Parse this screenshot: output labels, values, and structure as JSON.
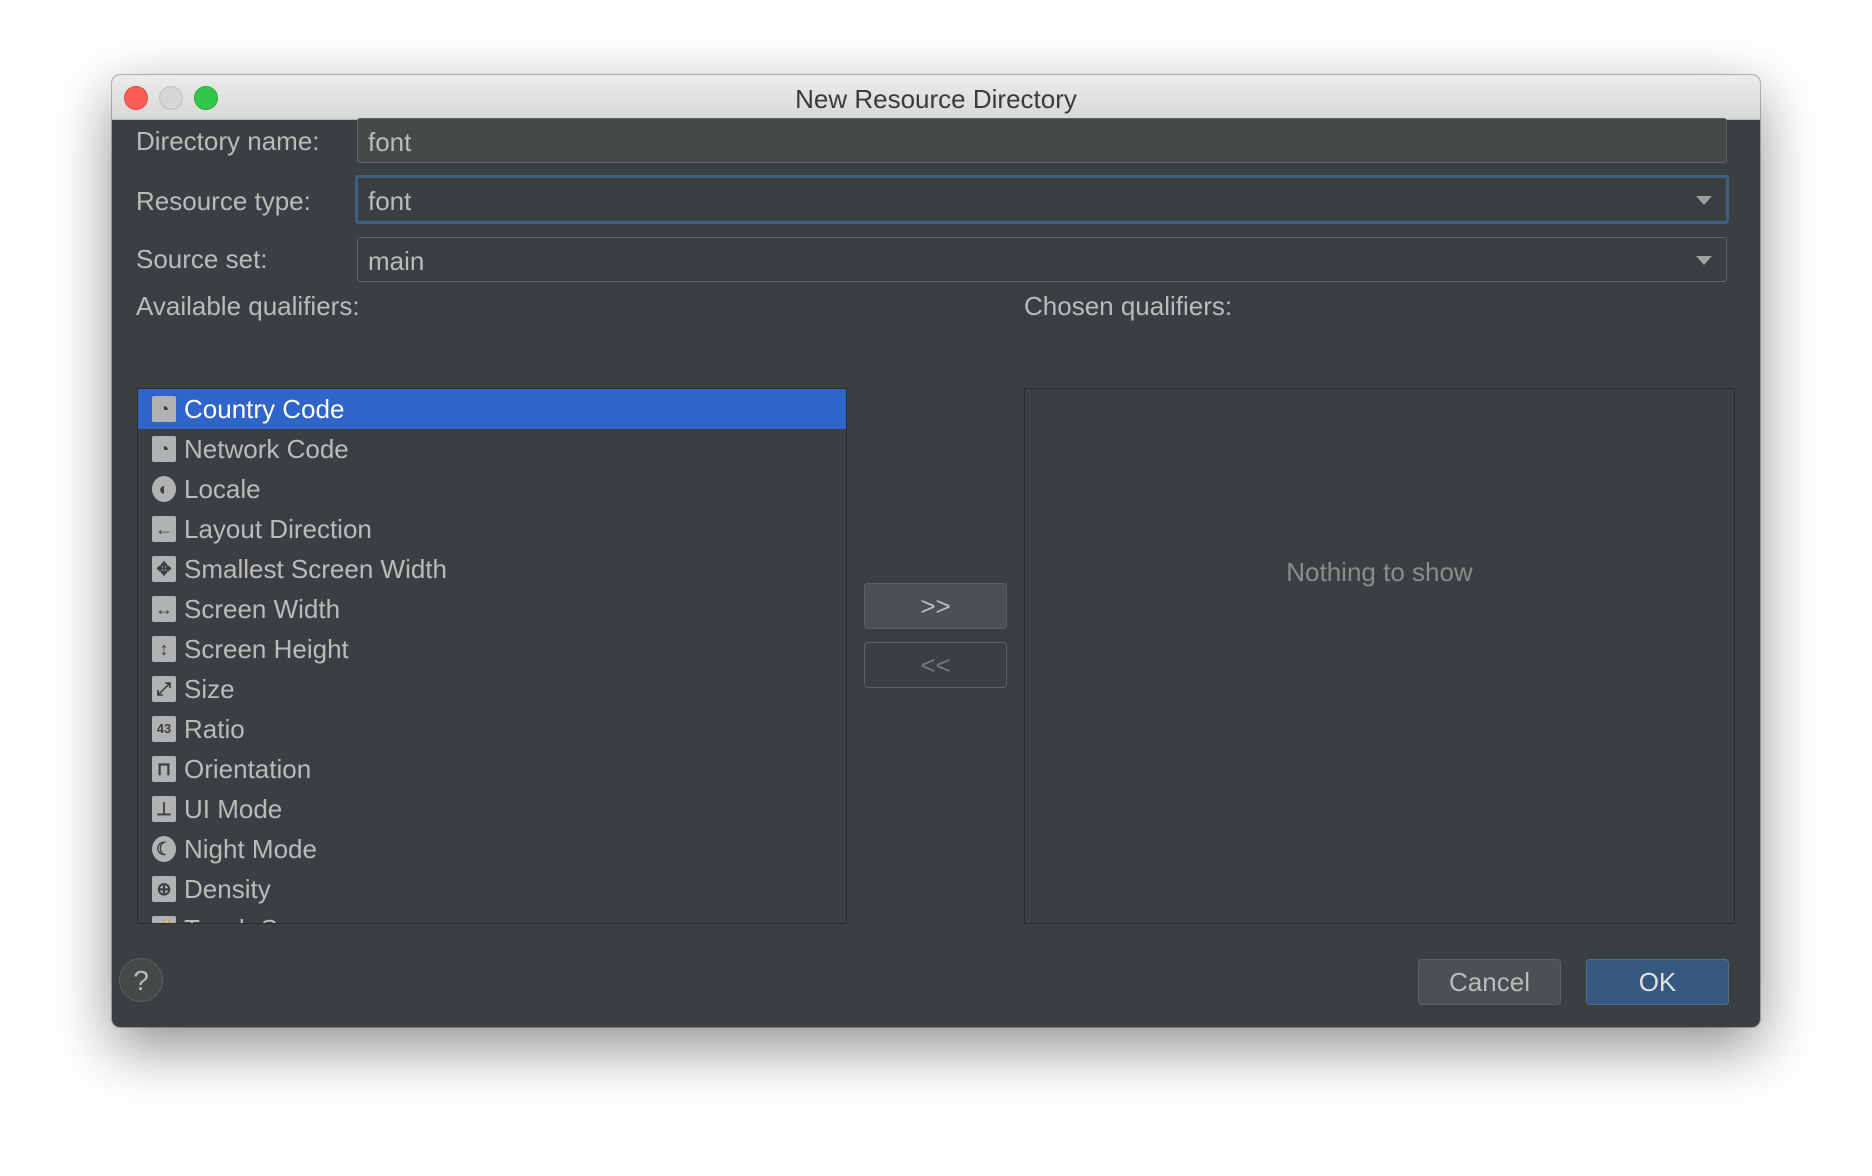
{
  "window": {
    "title": "New Resource Directory"
  },
  "form": {
    "directory_name": {
      "label": "Directory name:",
      "value": "font"
    },
    "resource_type": {
      "label": "Resource type:",
      "value": "font"
    },
    "source_set": {
      "label": "Source set:",
      "value": "main"
    }
  },
  "available": {
    "label": "Available qualifiers:",
    "items": [
      {
        "label": "Country Code",
        "icon": "country-code-icon",
        "glyph": "◔",
        "selected": true
      },
      {
        "label": "Network Code",
        "icon": "network-code-icon",
        "glyph": "◔"
      },
      {
        "label": "Locale",
        "icon": "globe-icon",
        "glyph": "◐"
      },
      {
        "label": "Layout Direction",
        "icon": "arrow-left-icon",
        "glyph": "←"
      },
      {
        "label": "Smallest Screen Width",
        "icon": "move-arrows-icon",
        "glyph": "✥"
      },
      {
        "label": "Screen Width",
        "icon": "horizontal-arrows-icon",
        "glyph": "↔"
      },
      {
        "label": "Screen Height",
        "icon": "vertical-arrows-icon",
        "glyph": "↕"
      },
      {
        "label": "Size",
        "icon": "resize-icon",
        "glyph": "⤢"
      },
      {
        "label": "Ratio",
        "icon": "ratio-icon",
        "glyph": "43"
      },
      {
        "label": "Orientation",
        "icon": "orientation-icon",
        "glyph": "⊓"
      },
      {
        "label": "UI Mode",
        "icon": "ui-mode-icon",
        "glyph": "⊥"
      },
      {
        "label": "Night Mode",
        "icon": "moon-icon",
        "glyph": "☾"
      },
      {
        "label": "Density",
        "icon": "density-icon",
        "glyph": "⊕"
      },
      {
        "label": "Touch Screen",
        "icon": "touch-screen-icon",
        "glyph": "☝"
      }
    ]
  },
  "chosen": {
    "label": "Chosen qualifiers:",
    "empty_text": "Nothing to show"
  },
  "buttons": {
    "add": ">>",
    "remove": "<<",
    "help": "?",
    "cancel": "Cancel",
    "ok": "OK"
  },
  "colors": {
    "selection": "#2f65ca",
    "background": "#3c3f41",
    "ok": "#365880",
    "focus": "#3d6185"
  }
}
